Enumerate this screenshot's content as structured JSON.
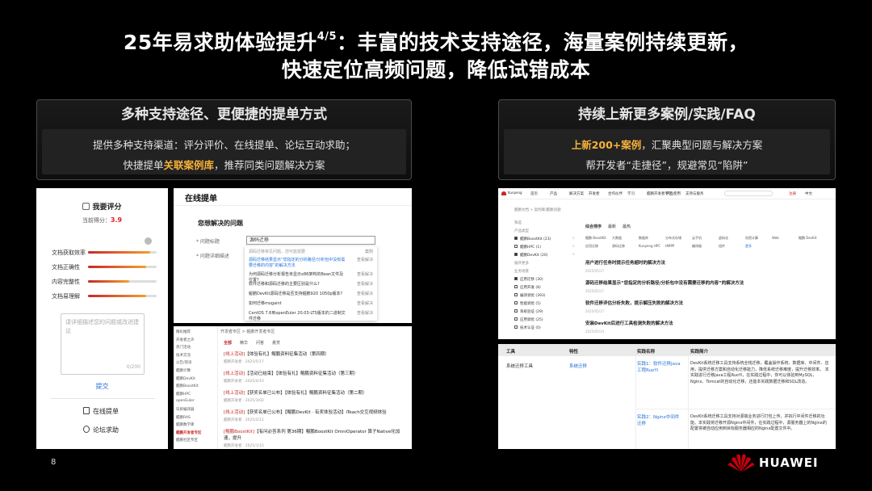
{
  "title": {
    "line1_pre": "25年易求助体验提升",
    "line1_sup": "4/5",
    "line1_post": "：丰富的技术支持途径，海量案例持续更新，",
    "line2": "快速定位高频问题，降低试错成本"
  },
  "left_panel": {
    "heading": "多种支持途径、更便捷的提单方式",
    "line1": "提供多种支持渠道：评分评价、在线提单、论坛互动求助；",
    "line2_pre": "快捷提单",
    "line2_hl": "关联案例库",
    "line2_post": "，推荐同类问题解决方案"
  },
  "right_panel": {
    "heading": "持续上新更多案例/实践/FAQ",
    "line1_hl": "上新200+案例",
    "line1_post": "，汇聚典型问题与解决方案",
    "line2": "帮开发者“走捷径”，规避常见“陷阱”"
  },
  "rating_shot": {
    "heading": "我要评分",
    "score_label": "当前得分：",
    "score_value": "3.9",
    "rows": [
      {
        "label": "文档获取效率",
        "value": 0.9
      },
      {
        "label": "文档正确性",
        "value": 0.85
      },
      {
        "label": "内容完整性",
        "value": 0.6
      },
      {
        "label": "文档易理解",
        "value": 0.85
      }
    ],
    "textbox_placeholder": "请详细描述您的问题或改进建议",
    "textbox_count": "0/200",
    "submit": "提交",
    "link1": "在线提单",
    "link2": "论坛求助"
  },
  "ticket_shot": {
    "title": "在线提单",
    "subtitle": "您想解决的问题",
    "field1": "* 问题标题",
    "field2": "* 问题详细描述",
    "input_value": "源码迁移",
    "dropdown_head": "源码迁移常见问题，您可能需要",
    "dropdown_tag": "案例",
    "items": [
      "源码迁移结果显示“您指定的分析路径/分析包中没有需要迁移的内容”的解决方法",
      "为何源码迁移分析报告未显示x86架构的Bean文件及位置?",
      "软件迁移和源码迁移的主要区别是什么?",
      "鲲鹏DevKit源码迁移是否支持鲲鹏920 1050p版本?",
      "如何迁移mogaint",
      "CentOS 7.6到openEuler 20.03-LTS版本的二进制文件迁移"
    ],
    "item_tag": "查看解决"
  },
  "forum_shot": {
    "side": [
      "精彩推荐",
      "开发者之声",
      "热门活动",
      "技术交流",
      "公告/资讯",
      "鲲鹏计算",
      "鲲鹏DevKit",
      "鲲鹏BoostKit",
      "鲲鹏HPC",
      "openEuler",
      "毕昇编译器",
      "鲲鹏RAS",
      "鲲鹏数学库",
      "鲲鹏开发者专区",
      "鲲鹏社区专区"
    ],
    "side_active_index": 13,
    "topbar": "开发者专区 > 鲲鹏开发者专区",
    "tabs": [
      "全部",
      "精华",
      "问答",
      "悬赏"
    ],
    "posts": [
      {
        "tag": "[线上活动]",
        "text": "【体验有礼】鲲鹏资料征集活动（第四期）",
        "meta": "鲲鹏开发者 · 2025/5/17"
      },
      {
        "tag": "[线上活动]",
        "text": "【活动已结束】【体验有礼】鲲鹏资料征集活动（第三期）",
        "meta": "鲲鹏开发者 · 2025/4/10"
      },
      {
        "tag": "[线上活动]",
        "text": "【获奖名单已公布】【体验有礼】鲲鹏资料征集活动（第二期）",
        "meta": "鲲鹏开发者 · 2025/3/02"
      },
      {
        "tag": "[线上活动]",
        "text": "【获奖名单已公布】【鲲鹏DevKit · 有奖体验活动】iTeach交互视频体验",
        "meta": "鲲鹏开发者 · 2025/2/11"
      },
      {
        "tag": "[鲲鹏BoostKit]",
        "text": "【有问必答系列 第36期】鲲鹏BoostKit OmniOperator 算子Native化加速，提升",
        "meta": "鲲鹏开发者 · 2025/1/15"
      }
    ]
  },
  "case_shot": {
    "brand": "Kunpeng",
    "nav": [
      "首页",
      "产品",
      "解决方案",
      "开发者",
      "合作伙伴",
      "学习",
      "鲲鹏开发者专区",
      "产品使用",
      "支持与服务"
    ],
    "nav_right": [
      "注册",
      "中文"
    ],
    "crumb": "鲲鹏文档 > 案例库/鲲鹏问题",
    "filters": [
      {
        "label": "筛选",
        "count": "",
        "checked": false,
        "header": true
      },
      {
        "label": "产品类型",
        "count": "",
        "checked": false,
        "header": true
      },
      {
        "label": "鲲鹏BoostKit (23)",
        "count": ">",
        "checked": true,
        "header": false
      },
      {
        "label": "鲲鹏HPC (1)",
        "count": ">",
        "checked": false,
        "header": false
      },
      {
        "label": "鲲鹏DevKit (20)",
        "count": ">",
        "checked": true,
        "header": false
      },
      {
        "label": "展开更多",
        "count": "",
        "checked": false,
        "header": true
      },
      {
        "label": "业务场景",
        "count": "",
        "checked": false,
        "header": true
      },
      {
        "label": "应用迁移 (30)",
        "count": "",
        "checked": true,
        "header": false
      },
      {
        "label": "应用开发 (8)",
        "count": "",
        "checked": false,
        "header": false
      },
      {
        "label": "编译调优 (393)",
        "count": "",
        "checked": false,
        "header": false
      },
      {
        "label": "性能调优 (5)",
        "count": "",
        "checked": false,
        "header": false
      },
      {
        "label": "系统验证 (29)",
        "count": "",
        "checked": false,
        "header": false
      },
      {
        "label": "应用调优 (25)",
        "count": "",
        "checked": false,
        "header": false
      },
      {
        "label": "技术认证 (0)",
        "count": "",
        "checked": false,
        "header": false
      }
    ],
    "sort": [
      "综合排序",
      "最新",
      "最热"
    ],
    "tags": [
      "鲲鹏 BoostKit",
      "大数据",
      "数据库",
      "分布式存储",
      "云手机",
      "虚拟化",
      "机密计算",
      "Web",
      "鲲鹏 DevKit",
      "应用迁移",
      "源码迁移",
      "Kunpeng HPC",
      "HMPP",
      "编译器",
      "组件",
      "更多"
    ],
    "cases": [
      {
        "title": "用户进行任务时提示任务超时的解决方法",
        "date": "2025/05/17"
      },
      {
        "title": "源码迁移结果显示“您指定的分析路径/分析包中没有需要迁移的内容”的解决方法",
        "date": "2025/05/17"
      },
      {
        "title": "软件迁移评估分析失败，提示解压失败的解决方法",
        "date": "2025/05/17"
      },
      {
        "title": "安装DevKit后进行工具检测失败的解决方法",
        "date": "2025/05/14"
      }
    ]
  },
  "table_shot": {
    "headers": [
      "工具",
      "特性",
      "实践名称",
      "实践简介"
    ],
    "tool": "系统迁移工具",
    "feature": "系统迁移",
    "practices": [
      {
        "name": "实践1：软件迁移Java工程RuoYi",
        "intro": "DevKit系统迁移工具支持系统全栈迁移，覆盖操作系统、数据库、中间件、应用，提供迁移方案和自动化迁移能力，降低系统迁移难度，提升迁移效率。 本实践进行迁移Java工程RuoYi，在实践过程中，你可以体验到MySQL、Nginx、Tomcat的自动化迁移，还能本实践数据迁移和SQL改造。"
      },
      {
        "name": "实践2：Nginx中间件迁移",
        "intro": "DevKit系统迁移工具支持对源端业务进行打包上传，并执行中间件迁移的功能。本实践将迁移开源Nginx中间件，在实践过程中，源服务器上的Nginx的配置将被自动应用到目标服务器相应的Nginx配置文件中。"
      }
    ]
  },
  "page_number": "8",
  "brand": "HUAWEI",
  "colors": {
    "accent": "#f7b23a",
    "huawei_red": "#c7000b",
    "link_blue": "#1f6fd8"
  }
}
